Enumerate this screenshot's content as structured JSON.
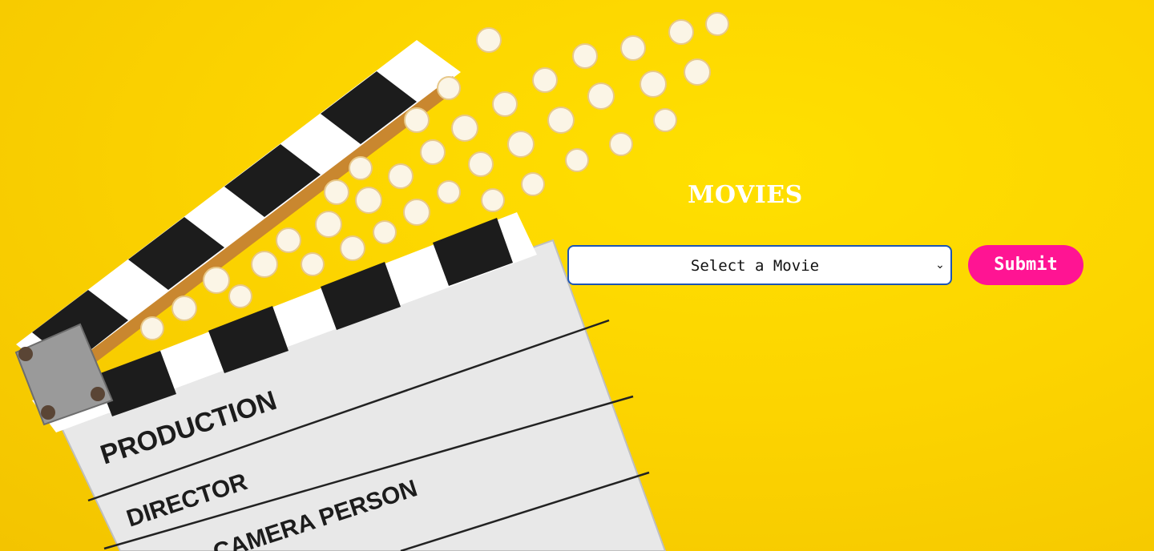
{
  "page": {
    "title": "MOVIES",
    "background_color": "#fcd400"
  },
  "movie_select": {
    "selected_label": "Select a Movie",
    "icon": "chevron-down-icon"
  },
  "submit_button": {
    "label": "Submit",
    "color": "#ff1493"
  },
  "clapperboard": {
    "lines": [
      "PRODUCTION",
      "DIRECTOR",
      "CAMERA PERSON"
    ]
  }
}
